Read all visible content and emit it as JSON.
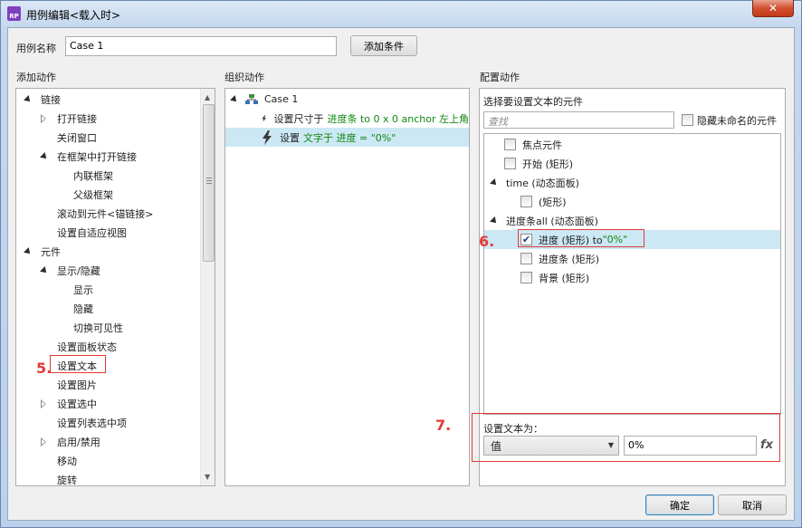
{
  "window": {
    "app_icon_text": "RP",
    "title": "用例编辑<载入时>",
    "close_glyph": "✕"
  },
  "case_name": {
    "label": "用例名称",
    "value": "Case 1",
    "add_condition_button": "添加条件"
  },
  "add_actions": {
    "header": "添加动作",
    "items": [
      {
        "label": "链接",
        "level": 0,
        "toggle": "expanded"
      },
      {
        "label": "打开链接",
        "level": 1,
        "toggle": "collapsed"
      },
      {
        "label": "关闭窗口",
        "level": 1,
        "toggle": "none"
      },
      {
        "label": "在框架中打开链接",
        "level": 1,
        "toggle": "expanded"
      },
      {
        "label": "内联框架",
        "level": 2,
        "toggle": "none"
      },
      {
        "label": "父级框架",
        "level": 2,
        "toggle": "none"
      },
      {
        "label": "滚动到元件<锚链接>",
        "level": 1,
        "toggle": "none"
      },
      {
        "label": "设置自适应视图",
        "level": 1,
        "toggle": "none"
      },
      {
        "label": "元件",
        "level": 0,
        "toggle": "expanded"
      },
      {
        "label": "显示/隐藏",
        "level": 1,
        "toggle": "expanded"
      },
      {
        "label": "显示",
        "level": 2,
        "toggle": "none"
      },
      {
        "label": "隐藏",
        "level": 2,
        "toggle": "none"
      },
      {
        "label": "切换可见性",
        "level": 2,
        "toggle": "none"
      },
      {
        "label": "设置面板状态",
        "level": 1,
        "toggle": "none"
      },
      {
        "label": "设置文本",
        "level": 1,
        "toggle": "none"
      },
      {
        "label": "设置图片",
        "level": 1,
        "toggle": "none"
      },
      {
        "label": "设置选中",
        "level": 1,
        "toggle": "collapsed"
      },
      {
        "label": "设置列表选中项",
        "level": 1,
        "toggle": "none"
      },
      {
        "label": "启用/禁用",
        "level": 1,
        "toggle": "collapsed"
      },
      {
        "label": "移动",
        "level": 1,
        "toggle": "none"
      },
      {
        "label": "旋转",
        "level": 1,
        "toggle": "none"
      }
    ],
    "annotation_number": "5."
  },
  "organize_actions": {
    "header": "组织动作",
    "case_label": "Case 1",
    "actions": [
      {
        "prefix": "设置尺寸于",
        "detail": "进度条 to 0 x 0 anchor 左上角",
        "selected": false
      },
      {
        "prefix": "设置",
        "detail": "文字于 进度 = \"0%\"",
        "selected": true
      }
    ]
  },
  "configure_actions": {
    "header": "配置动作",
    "subheader": "选择要设置文本的元件",
    "search_placeholder": "查找",
    "hide_unnamed_label": "隐藏未命名的元件",
    "hide_unnamed_checked": false,
    "widgets": [
      {
        "label": "焦点元件",
        "level": 0,
        "toggle": "none",
        "checkbox": true,
        "checked": false,
        "highlight": ""
      },
      {
        "label": "开始 (矩形)",
        "level": 0,
        "toggle": "none",
        "checkbox": true,
        "checked": false,
        "highlight": ""
      },
      {
        "label": "time (动态面板)",
        "level": 0,
        "toggle": "expanded",
        "checkbox": false,
        "checked": false,
        "highlight": ""
      },
      {
        "label": "(矩形)",
        "level": 1,
        "toggle": "none",
        "checkbox": true,
        "checked": false,
        "highlight": ""
      },
      {
        "label": "进度条all (动态面板)",
        "level": 0,
        "toggle": "expanded",
        "checkbox": false,
        "checked": false,
        "highlight": ""
      },
      {
        "label": "进度 (矩形) to ",
        "level": 1,
        "toggle": "none",
        "checkbox": true,
        "checked": true,
        "highlight": "\"0%\""
      },
      {
        "label": "进度条 (矩形)",
        "level": 1,
        "toggle": "none",
        "checkbox": true,
        "checked": false,
        "highlight": ""
      },
      {
        "label": "背景 (矩形)",
        "level": 1,
        "toggle": "none",
        "checkbox": true,
        "checked": false,
        "highlight": ""
      }
    ],
    "annotation_number": "6.",
    "set_text_label": "设置文本为：",
    "value_type": "值",
    "value_input": "0%",
    "fx_label": "fx",
    "annotation_number_7": "7."
  },
  "footer": {
    "ok_button": "确定",
    "cancel_button": "取消"
  },
  "colors": {
    "selection": "#cce8f4",
    "green_text": "#118811",
    "annotation_red": "#e53935"
  }
}
